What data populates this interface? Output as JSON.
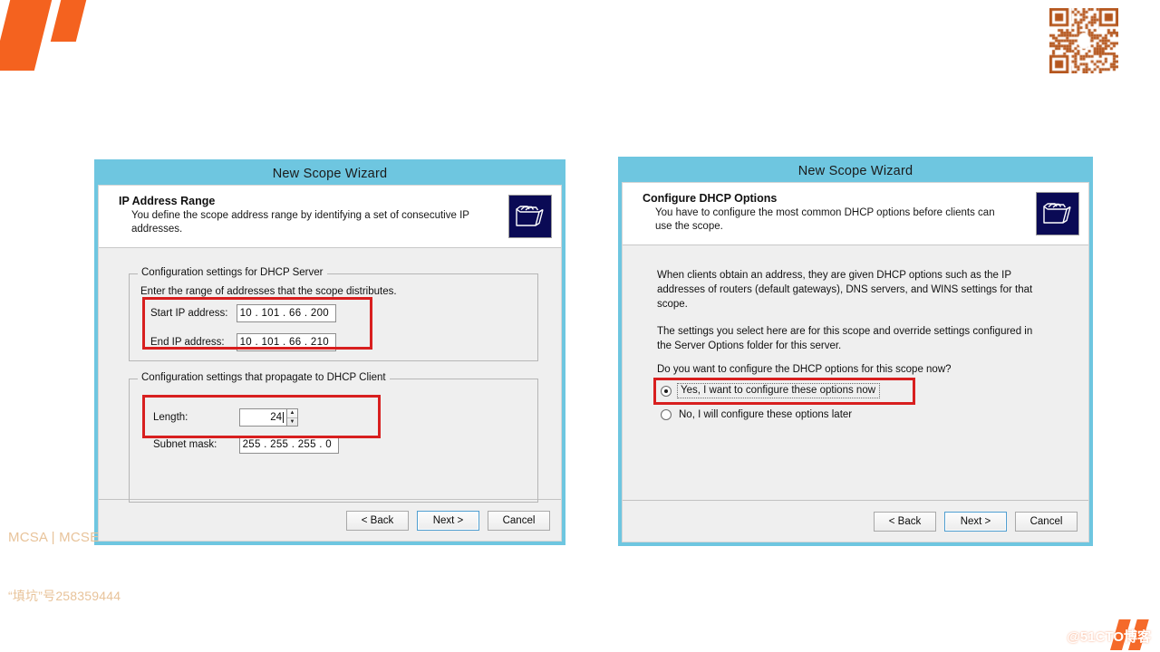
{
  "slide": {
    "logo_name": "orange-slash-logo",
    "accent_color": "#f4621f",
    "dialog_border_color": "#6ec6e0",
    "annotation_color": "#d81f1f",
    "watermark_left_line1": "MCSA | MCSE",
    "watermark_left_line2": "“填坑”号258359444",
    "watermark_right": "@51CTO博客",
    "qr_label": "qr-code"
  },
  "left_dialog": {
    "title": "New Scope Wizard",
    "header_title": "IP Address Range",
    "header_sub": "You define the scope address range by identifying a set of consecutive IP addresses.",
    "icon_name": "stacked-folders-icon",
    "group1_legend": "Configuration settings for DHCP Server",
    "group1_hint": "Enter the range of addresses that the scope distributes.",
    "start_ip_label": "Start IP address:",
    "start_ip_value": "10 . 101 . 66 . 200",
    "end_ip_label": "End IP address:",
    "end_ip_value": "10 . 101 . 66 . 210",
    "group2_legend": "Configuration settings that propagate to DHCP Client",
    "length_label": "Length:",
    "length_value": "24",
    "subnet_label": "Subnet mask:",
    "subnet_value": "255 . 255 . 255 .  0",
    "spin_up": "▲",
    "spin_down": "▼",
    "buttons": {
      "back": "< Back",
      "next": "Next >",
      "cancel": "Cancel"
    }
  },
  "right_dialog": {
    "title": "New Scope Wizard",
    "header_title": "Configure DHCP Options",
    "header_sub": "You have to configure the most common DHCP options before clients can use the scope.",
    "icon_name": "stacked-folders-icon",
    "para1": "When clients obtain an address, they are given DHCP options such as the IP addresses of routers (default gateways), DNS servers, and WINS settings for that scope.",
    "para2": "The settings you select here are for this scope and override settings configured in the Server Options folder for this server.",
    "question": "Do you want to configure the DHCP options for this scope now?",
    "option_yes": "Yes, I want to configure these options now",
    "option_no": "No, I will configure these options later",
    "selected_option": "yes",
    "buttons": {
      "back": "< Back",
      "next": "Next >",
      "cancel": "Cancel"
    }
  }
}
